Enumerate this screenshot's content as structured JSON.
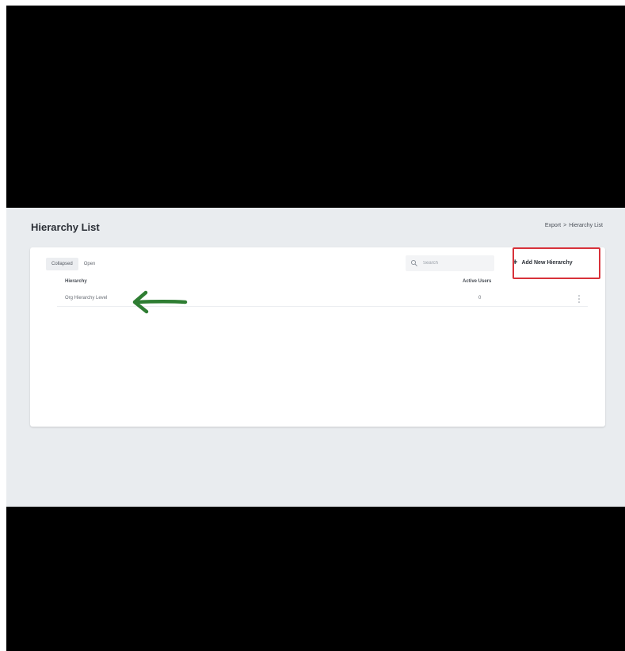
{
  "page": {
    "title": "Hierarchy List",
    "breadcrumb": [
      "Export",
      "Hierarchy List"
    ]
  },
  "toolbar": {
    "tabs": [
      {
        "label": "Collapsed",
        "active": true
      },
      {
        "label": "Open",
        "active": false
      }
    ],
    "search_placeholder": "Search",
    "add_button_label": "Add New Hierarchy"
  },
  "table": {
    "columns": [
      "Hierarchy",
      "Active Users"
    ],
    "rows": [
      {
        "hierarchy": "Org Hierarchy Level",
        "active_users": "0"
      }
    ]
  },
  "colors": {
    "highlight": "#d8323a",
    "arrow": "#2e7d32",
    "background": "#e9ecef"
  },
  "icons": {
    "search": "search-icon",
    "add": "plus-icon",
    "row_menu": "kebab-menu-icon"
  }
}
